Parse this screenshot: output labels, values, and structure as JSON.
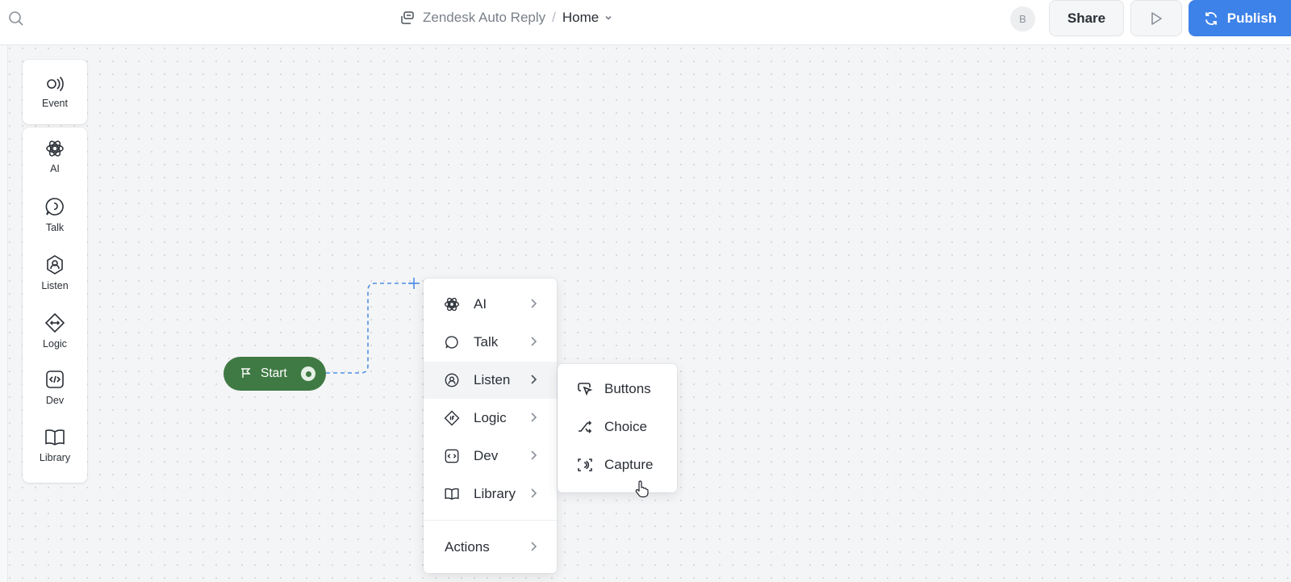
{
  "header": {
    "project_name": "Zendesk Auto Reply",
    "separator": "/",
    "page_name": "Home",
    "avatar_initial": "B",
    "share_label": "Share",
    "publish_label": "Publish"
  },
  "sidebar": {
    "event_label": "Event",
    "items": [
      {
        "label": "AI",
        "icon": "ai-icon"
      },
      {
        "label": "Talk",
        "icon": "talk-icon"
      },
      {
        "label": "Listen",
        "icon": "listen-icon"
      },
      {
        "label": "Logic",
        "icon": "logic-icon"
      },
      {
        "label": "Dev",
        "icon": "dev-icon"
      },
      {
        "label": "Library",
        "icon": "library-icon"
      }
    ]
  },
  "canvas": {
    "start_label": "Start"
  },
  "menu": {
    "items": [
      {
        "label": "AI"
      },
      {
        "label": "Talk"
      },
      {
        "label": "Listen"
      },
      {
        "label": "Logic"
      },
      {
        "label": "Dev"
      },
      {
        "label": "Library"
      }
    ],
    "actions_label": "Actions",
    "submenu": [
      {
        "label": "Buttons"
      },
      {
        "label": "Choice"
      },
      {
        "label": "Capture"
      }
    ]
  },
  "colors": {
    "accent": "#3d82e8",
    "start_node": "#3f7a44"
  }
}
